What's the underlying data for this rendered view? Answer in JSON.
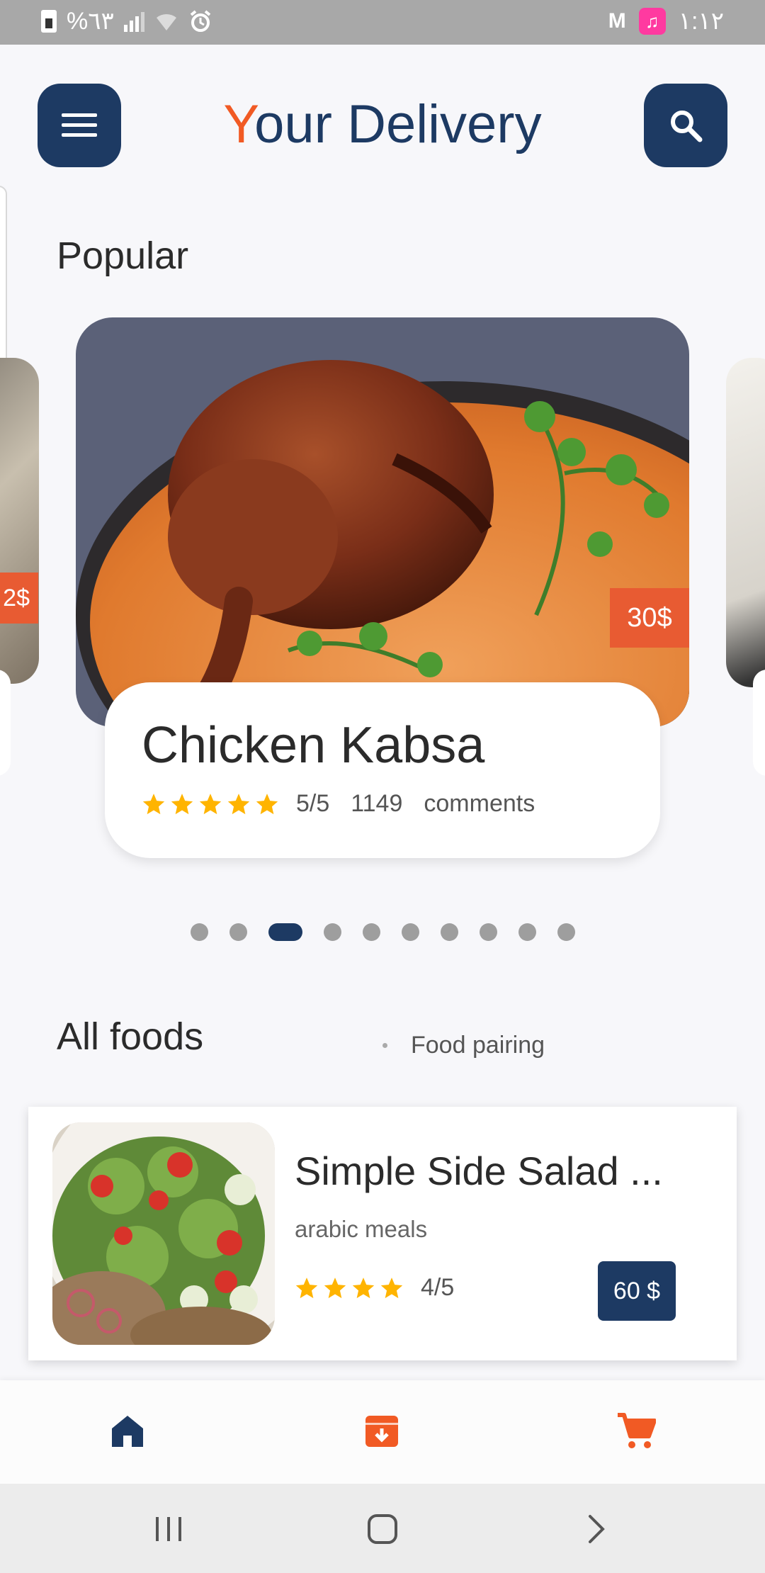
{
  "status_bar": {
    "battery_percent": "%٦٣",
    "time": "١:١٢"
  },
  "header": {
    "title_first": "Y",
    "title_rest": "our Delivery",
    "accent_color": "#f15a24",
    "brand_color": "#1d3a63"
  },
  "popular": {
    "section_title": "Popular",
    "left_card_price": "2$",
    "featured": {
      "name": "Chicken Kabsa",
      "price": "30$",
      "stars": 5,
      "rating": "5/5",
      "comments_count": "1149",
      "comments_label": "comments"
    },
    "pager": {
      "count": 10,
      "active_index": 2
    }
  },
  "all_foods": {
    "section_title": "All foods",
    "tab_label": "Food pairing",
    "items": [
      {
        "name": "Simple Side Salad ...",
        "category": "arabic meals",
        "stars": 4,
        "rating": "4/5",
        "price": "60 $"
      }
    ]
  },
  "bottom_nav": {
    "items": [
      {
        "icon": "home-icon",
        "color": "#1d3a63"
      },
      {
        "icon": "archive-icon",
        "color": "#f15a24"
      },
      {
        "icon": "cart-icon",
        "color": "#f15a24"
      }
    ]
  },
  "colors": {
    "star": "#ffb400",
    "price_tag": "#e85b32"
  }
}
